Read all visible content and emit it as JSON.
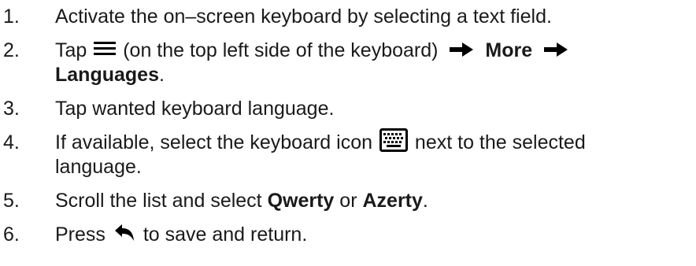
{
  "steps": [
    {
      "number": "1.",
      "text": "Activate the on–screen keyboard by selecting a text field."
    },
    {
      "number": "2.",
      "text_before_icon": "Tap",
      "icon_menu": "menu-icon",
      "text_after_icon": "(on the top left side of the keyboard)",
      "arrow_icon": "right-arrow-icon",
      "bold_more": "More",
      "bold_languages": "Languages",
      "trailing_period": "."
    },
    {
      "number": "3.",
      "text": "Tap wanted keyboard language."
    },
    {
      "number": "4.",
      "text_before_icon": "If available, select the keyboard icon",
      "icon_keyboard": "keyboard-icon",
      "text_after_icon": "next to the selected language."
    },
    {
      "number": "5.",
      "text_before": "Scroll the list and select",
      "bold_qwerty": "Qwerty",
      "text_or": "or",
      "bold_azerty": "Azerty",
      "trailing_period": "."
    },
    {
      "number": "6.",
      "text_before_icon": "Press",
      "icon_back": "back-arrow-icon",
      "text_after_icon": "to save and return."
    }
  ],
  "colors": {
    "text": "#1a1a1a",
    "icon": "#000000",
    "background": "#ffffff"
  }
}
